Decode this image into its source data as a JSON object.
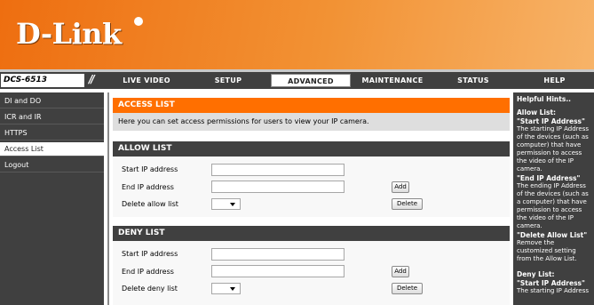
{
  "brand": {
    "logo_text": "D-Link"
  },
  "nav": {
    "model": "DCS-6513",
    "slashes": "//",
    "tabs": [
      "LIVE VIDEO",
      "SETUP",
      "ADVANCED",
      "MAINTENANCE",
      "STATUS",
      "HELP"
    ],
    "active_tab": "ADVANCED"
  },
  "sidebar": {
    "items": [
      {
        "label": "DI and DO"
      },
      {
        "label": "ICR and IR"
      },
      {
        "label": "HTTPS"
      },
      {
        "label": "Access List"
      },
      {
        "label": "Logout"
      }
    ],
    "active_item": "Access List"
  },
  "access": {
    "title": "ACCESS LIST",
    "description": "Here you can set access permissions for users to view your IP camera."
  },
  "allow": {
    "title": "ALLOW LIST",
    "start_label": "Start IP address",
    "end_label": "End IP address",
    "delete_label": "Delete allow list",
    "start_value": "",
    "end_value": "",
    "add_button": "Add",
    "delete_button": "Delete"
  },
  "deny": {
    "title": "DENY LIST",
    "start_label": "Start IP address",
    "end_label": "End IP address",
    "delete_label": "Delete deny list",
    "start_value": "",
    "end_value": "",
    "add_button": "Add",
    "delete_button": "Delete"
  },
  "hints": {
    "title": "Helpful Hints..",
    "allow_heading": "Allow List:",
    "allow_start_term": "\"Start IP Address\"",
    "allow_start_text": "The starting IP Address of the devices (such as computer) that have permission to access the video of the IP camera.",
    "allow_end_term": "\"End IP Address\"",
    "allow_end_text": "The ending IP Address of the devices (such as a computer) that have permission to access the video of the IP camera.",
    "allow_delete_term": "\"Delete Allow List\"",
    "allow_delete_text": "Remove the customized setting from the Allow List.",
    "deny_heading": "Deny List:",
    "deny_start_term": "\"Start IP Address\"",
    "deny_start_text": "The starting IP Address"
  },
  "colors": {
    "accent": "#ff6f00",
    "dark_panel": "#404040"
  }
}
